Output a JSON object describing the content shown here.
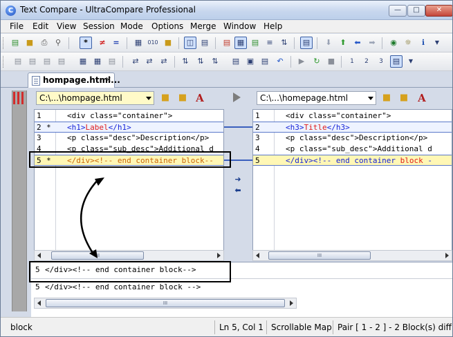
{
  "window": {
    "title": "Text Compare - UltraCompare Professional"
  },
  "menu": [
    "File",
    "Edit",
    "View",
    "Session",
    "Mode",
    "Options",
    "Merge",
    "Window",
    "Help"
  ],
  "document_tab": {
    "label": "hompage.html..."
  },
  "left_pane": {
    "path": "C:\\...\\hompage.html",
    "lines": [
      {
        "no": "1",
        "mark": "",
        "code": "<div class=\"container\">"
      },
      {
        "no": "2",
        "mark": "*",
        "tag_open": "<h1>",
        "word": "Label",
        "tag_close": "</h1>"
      },
      {
        "no": "3",
        "mark": "",
        "code": "<p class=\"desc\">Description</p>"
      },
      {
        "no": "4",
        "mark": "",
        "code": "<p class=\"sub_desc\">Additional d"
      },
      {
        "no": "5",
        "mark": "*",
        "code": "</div><!-- end container block--"
      }
    ]
  },
  "right_pane": {
    "path": "C:\\...\\homepage.html",
    "lines": [
      {
        "no": "1",
        "mark": "",
        "code": "<div class=\"container\">"
      },
      {
        "no": "2",
        "mark": "",
        "tag_open": "<h3>",
        "word": "Title",
        "tag_close": "</h3>"
      },
      {
        "no": "3",
        "mark": "",
        "code": "<p class=\"desc\">Description</p>"
      },
      {
        "no": "4",
        "mark": "",
        "code": "<p class=\"sub_desc\">Additional d"
      },
      {
        "no": "5",
        "mark": "",
        "code_a": "</div><!-- end container ",
        "word": "block",
        "code_b": " -"
      }
    ]
  },
  "lower": {
    "line1": {
      "no": "5",
      "code": "</div><!-- end container block-->"
    },
    "line2": {
      "no": "5",
      "code_a": "</div><!-- end container ",
      "word": "block",
      "code_b": " -->"
    }
  },
  "scroll_thumb": "III",
  "status": {
    "message": "block",
    "position": "Ln 5, Col 1",
    "map": "Scrollable Map",
    "pair": "Pair [ 1 - 2 ] - 2 Block(s) diff"
  },
  "colors": {
    "diff_highlight": "#fff7b5",
    "diff_border": "#5a78c9",
    "changed_word": "#e01b1b",
    "tag_color": "#1522d8"
  }
}
